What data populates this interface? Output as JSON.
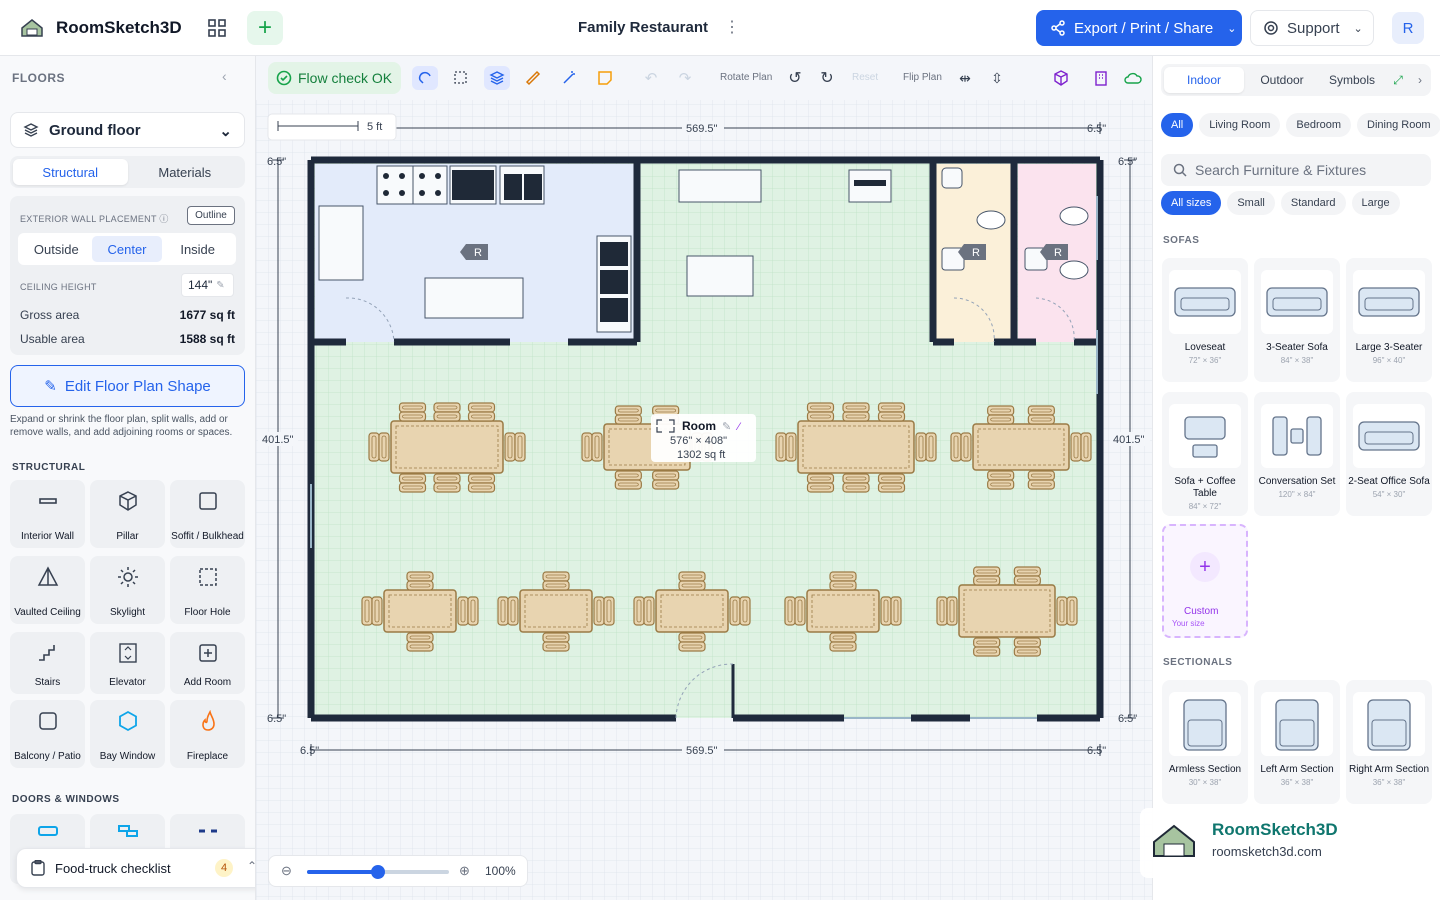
{
  "app": {
    "name": "RoomSketch3D",
    "project_title": "Family Restaurant",
    "export_label": "Export / Print / Share",
    "support_label": "Support",
    "user_initial": "R"
  },
  "left": {
    "floors_header": "FLOORS",
    "floor_name": "Ground floor",
    "tabs": [
      "Structural",
      "Materials"
    ],
    "wall_placement_label": "EXTERIOR WALL PLACEMENT",
    "outline_label": "Outline",
    "wall_modes": [
      "Outside",
      "Center",
      "Inside"
    ],
    "ceiling_label": "CEILING HEIGHT",
    "ceiling_value": "144\"",
    "gross_label": "Gross area",
    "gross_value": "1677 sq ft",
    "usable_label": "Usable area",
    "usable_value": "1588 sq ft",
    "edit_button": "Edit Floor Plan Shape",
    "help_text": "Expand or shrink the floor plan, split walls, add or remove walls, and add adjoining rooms or spaces.",
    "structural_header": "STRUCTURAL",
    "tools": [
      "Interior Wall",
      "Pillar",
      "Soffit / Bulkhead",
      "Vaulted Ceiling",
      "Skylight",
      "Floor Hole",
      "Stairs",
      "Elevator",
      "Add Room",
      "Balcony / Patio",
      "Bay Window",
      "Fireplace"
    ],
    "doors_header": "DOORS & WINDOWS",
    "checklist_label": "Food-truck checklist",
    "checklist_count": "4"
  },
  "toolbar": {
    "flow_label": "Flow check OK",
    "rotate_label": "Rotate Plan",
    "reset_label": "Reset",
    "flip_label": "Flip Plan"
  },
  "canvas": {
    "scale_label": "5 ft",
    "dim_top": "569.5\"",
    "dim_bottom": "569.5\"",
    "dim_left": "401.5\"",
    "dim_right": "401.5\"",
    "wall_thickness": "6.5\"",
    "room_name": "Room",
    "room_dims": "576\" × 408\"",
    "room_area": "1302 sq ft",
    "restroom_tag": "R",
    "zoom_label": "100%",
    "zoom_fraction": 0.5
  },
  "right": {
    "tabs": [
      "Indoor",
      "Outdoor",
      "Symbols"
    ],
    "rooms": [
      "All",
      "Living Room",
      "Bedroom",
      "Dining Room"
    ],
    "search_placeholder": "Search Furniture & Fixtures",
    "sizes": [
      "All sizes",
      "Small",
      "Standard",
      "Large"
    ],
    "sofas_header": "SOFAS",
    "sofas": [
      {
        "name": "Loveseat",
        "dims": "72\" × 36\""
      },
      {
        "name": "3-Seater Sofa",
        "dims": "84\" × 38\""
      },
      {
        "name": "Large 3-Seater",
        "dims": "96\" × 40\""
      },
      {
        "name": "Sofa + Coffee Table",
        "dims": "84\" × 72\""
      },
      {
        "name": "Conversation Set",
        "dims": "120\" × 84\""
      },
      {
        "name": "2-Seat Office Sofa",
        "dims": "54\" × 30\""
      }
    ],
    "custom_label": "Custom",
    "custom_sub": "Your size",
    "sectionals_header": "SECTIONALS",
    "sectionals": [
      {
        "name": "Armless Section",
        "dims": "30\" × 38\""
      },
      {
        "name": "Left Arm Section",
        "dims": "36\" × 38\""
      },
      {
        "name": "Right Arm Section",
        "dims": "36\" × 38\""
      }
    ]
  },
  "watermark": {
    "name": "RoomSketch3D",
    "url": "roomsketch3d.com"
  }
}
